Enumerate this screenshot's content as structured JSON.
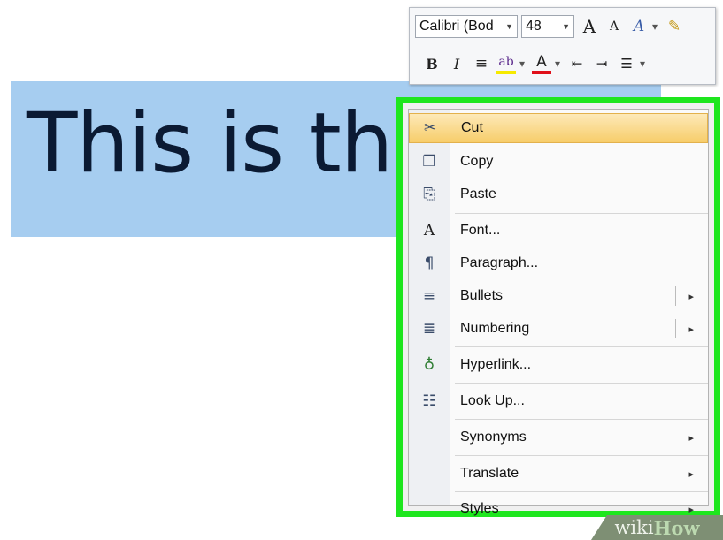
{
  "document": {
    "selected_text": "This is the"
  },
  "mini_toolbar": {
    "font_name": "Calibri (Bod",
    "font_size": "48",
    "row1": {
      "grow_font": "A",
      "shrink_font": "A",
      "styles": "A",
      "dropdown": "▾",
      "format_painter": "✎"
    },
    "row2": {
      "bold": "B",
      "italic": "I",
      "align": "≡",
      "highlight": "ab",
      "font_color": "A",
      "decrease_indent": "⇤",
      "increase_indent": "⇥",
      "bullets": "☰"
    },
    "highlight_color": "#f6ea00",
    "font_color_value": "#e0101a"
  },
  "context_menu": {
    "frame_color": "#1ee61e",
    "items": [
      {
        "label": "Cut",
        "icon": "✂"
      },
      {
        "label": "Copy",
        "icon": "❐"
      },
      {
        "label": "Paste",
        "icon": "⎘"
      },
      {
        "label": "Font...",
        "icon": "A"
      },
      {
        "label": "Paragraph...",
        "icon": "¶"
      },
      {
        "label": "Bullets",
        "icon": "≡",
        "submenu": "▸"
      },
      {
        "label": "Numbering",
        "icon": "≣",
        "submenu": "▸"
      },
      {
        "label": "Hyperlink...",
        "icon": "♁"
      },
      {
        "label": "Look Up...",
        "icon": "☷"
      },
      {
        "label": "Synonyms",
        "icon": "",
        "submenu": "▸"
      },
      {
        "label": "Translate",
        "icon": "",
        "submenu": "▸"
      },
      {
        "label": "Styles",
        "icon": "",
        "submenu": "▸"
      }
    ]
  },
  "watermark": {
    "wiki": "wiki",
    "how": "How"
  }
}
